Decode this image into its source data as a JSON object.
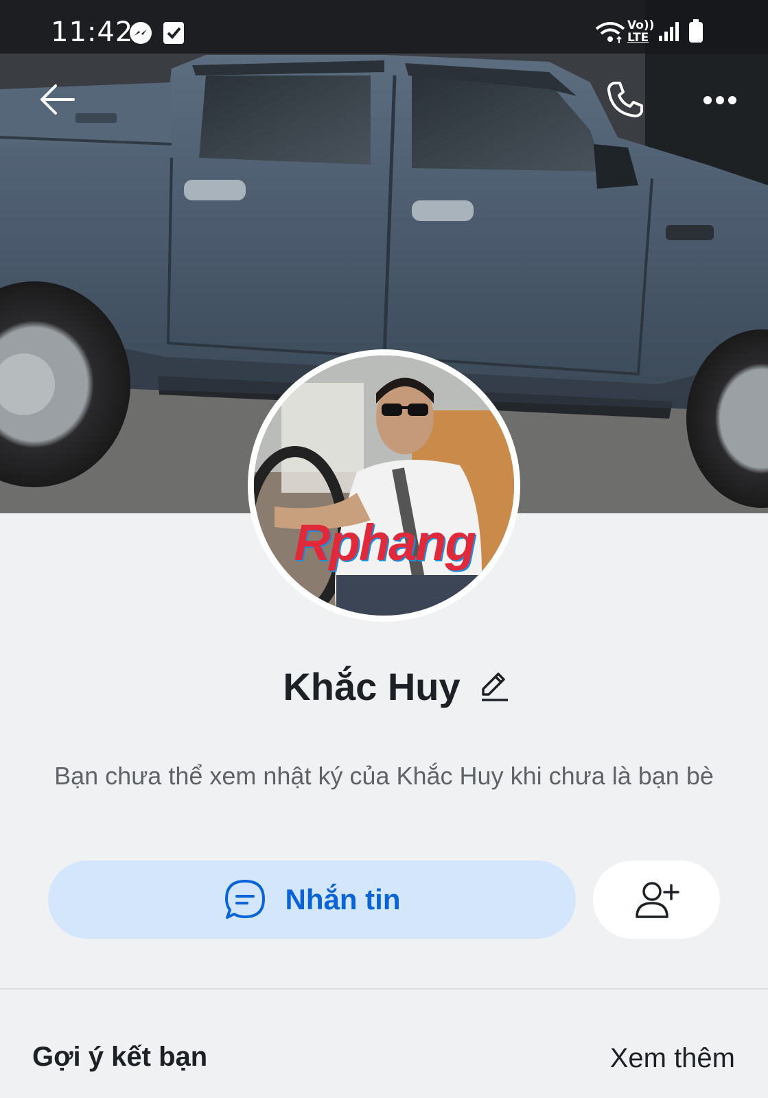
{
  "status_bar": {
    "time": "11:42",
    "icons": [
      "messenger-icon",
      "checkbox-icon",
      "wifi-icon",
      "volte-icon",
      "signal-icon",
      "battery-icon"
    ],
    "volte_text": "Vo))",
    "lte_text": "LTE"
  },
  "top_bar": {
    "back_icon": "back-arrow-icon",
    "call_icon": "phone-icon",
    "more_icon": "more-icon"
  },
  "profile": {
    "name": "Khắc Huy",
    "edit_icon": "pencil-icon",
    "watermark": "Rphang",
    "privacy_notice": "Bạn chưa thể xem nhật ký của Khắc Huy khi chưa là bạn bè"
  },
  "actions": {
    "message_label": "Nhắn tin",
    "message_icon": "chat-bubble-icon",
    "add_friend_icon": "add-friend-icon"
  },
  "suggestions": {
    "title": "Gợi ý kết bạn",
    "see_more": "Xem thêm"
  },
  "colors": {
    "accent": "#0a64d8",
    "message_button_bg": "#d4e6fc",
    "page_bg": "#eff1f3"
  }
}
